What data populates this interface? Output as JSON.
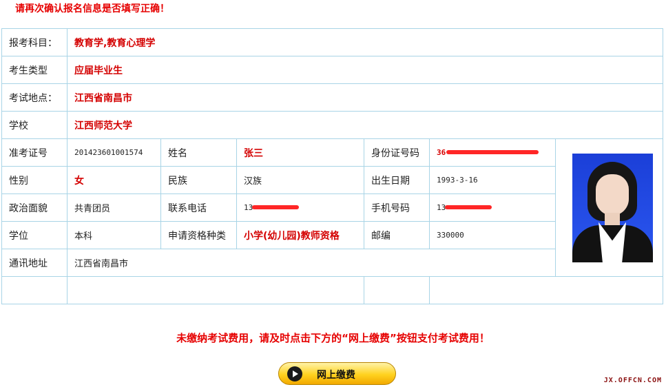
{
  "notice_top": "请再次确认报名信息是否填写正确！",
  "rows": {
    "subject": {
      "label": "报考科目：",
      "value": "教育学,教育心理学"
    },
    "category": {
      "label": "考生类型",
      "value": "应届毕业生"
    },
    "exam_location": {
      "label": "考试地点：",
      "value": "江西省南昌市"
    },
    "school": {
      "label": "学校",
      "value": "江西师范大学"
    },
    "ticket_no": {
      "label": "准考证号",
      "value": "201423601001574"
    },
    "name": {
      "label": "姓名",
      "value": "张三"
    },
    "id_no": {
      "label": "身份证号码",
      "value": "36"
    },
    "gender": {
      "label": "性别",
      "value": "女"
    },
    "ethnicity": {
      "label": "民族",
      "value": "汉族"
    },
    "birth_date": {
      "label": "出生日期",
      "value": "1993-3-16"
    },
    "political_status": {
      "label": "政治面貌",
      "value": "共青团员"
    },
    "phone": {
      "label": "联系电话",
      "value": "13"
    },
    "mobile": {
      "label": "手机号码",
      "value": "13"
    },
    "degree": {
      "label": "学位",
      "value": "本科"
    },
    "qualification_type": {
      "label": "申请资格种类",
      "value": "小学(幼儿园)教师资格"
    },
    "postcode": {
      "label": "邮编",
      "value": "330000"
    },
    "address": {
      "label": "通讯地址",
      "value": "江西省南昌市"
    }
  },
  "notice_mid": "未缴纳考试费用，请及时点击下方的“网上缴费”按钮支付考试费用！",
  "pay_button": {
    "label": "网上缴费",
    "icon": "play-icon"
  },
  "watermark": "JX.OFFCN.COM",
  "colors": {
    "accent_red": "#e60000",
    "border": "#a8d4e6",
    "button": "#ffd21f"
  }
}
